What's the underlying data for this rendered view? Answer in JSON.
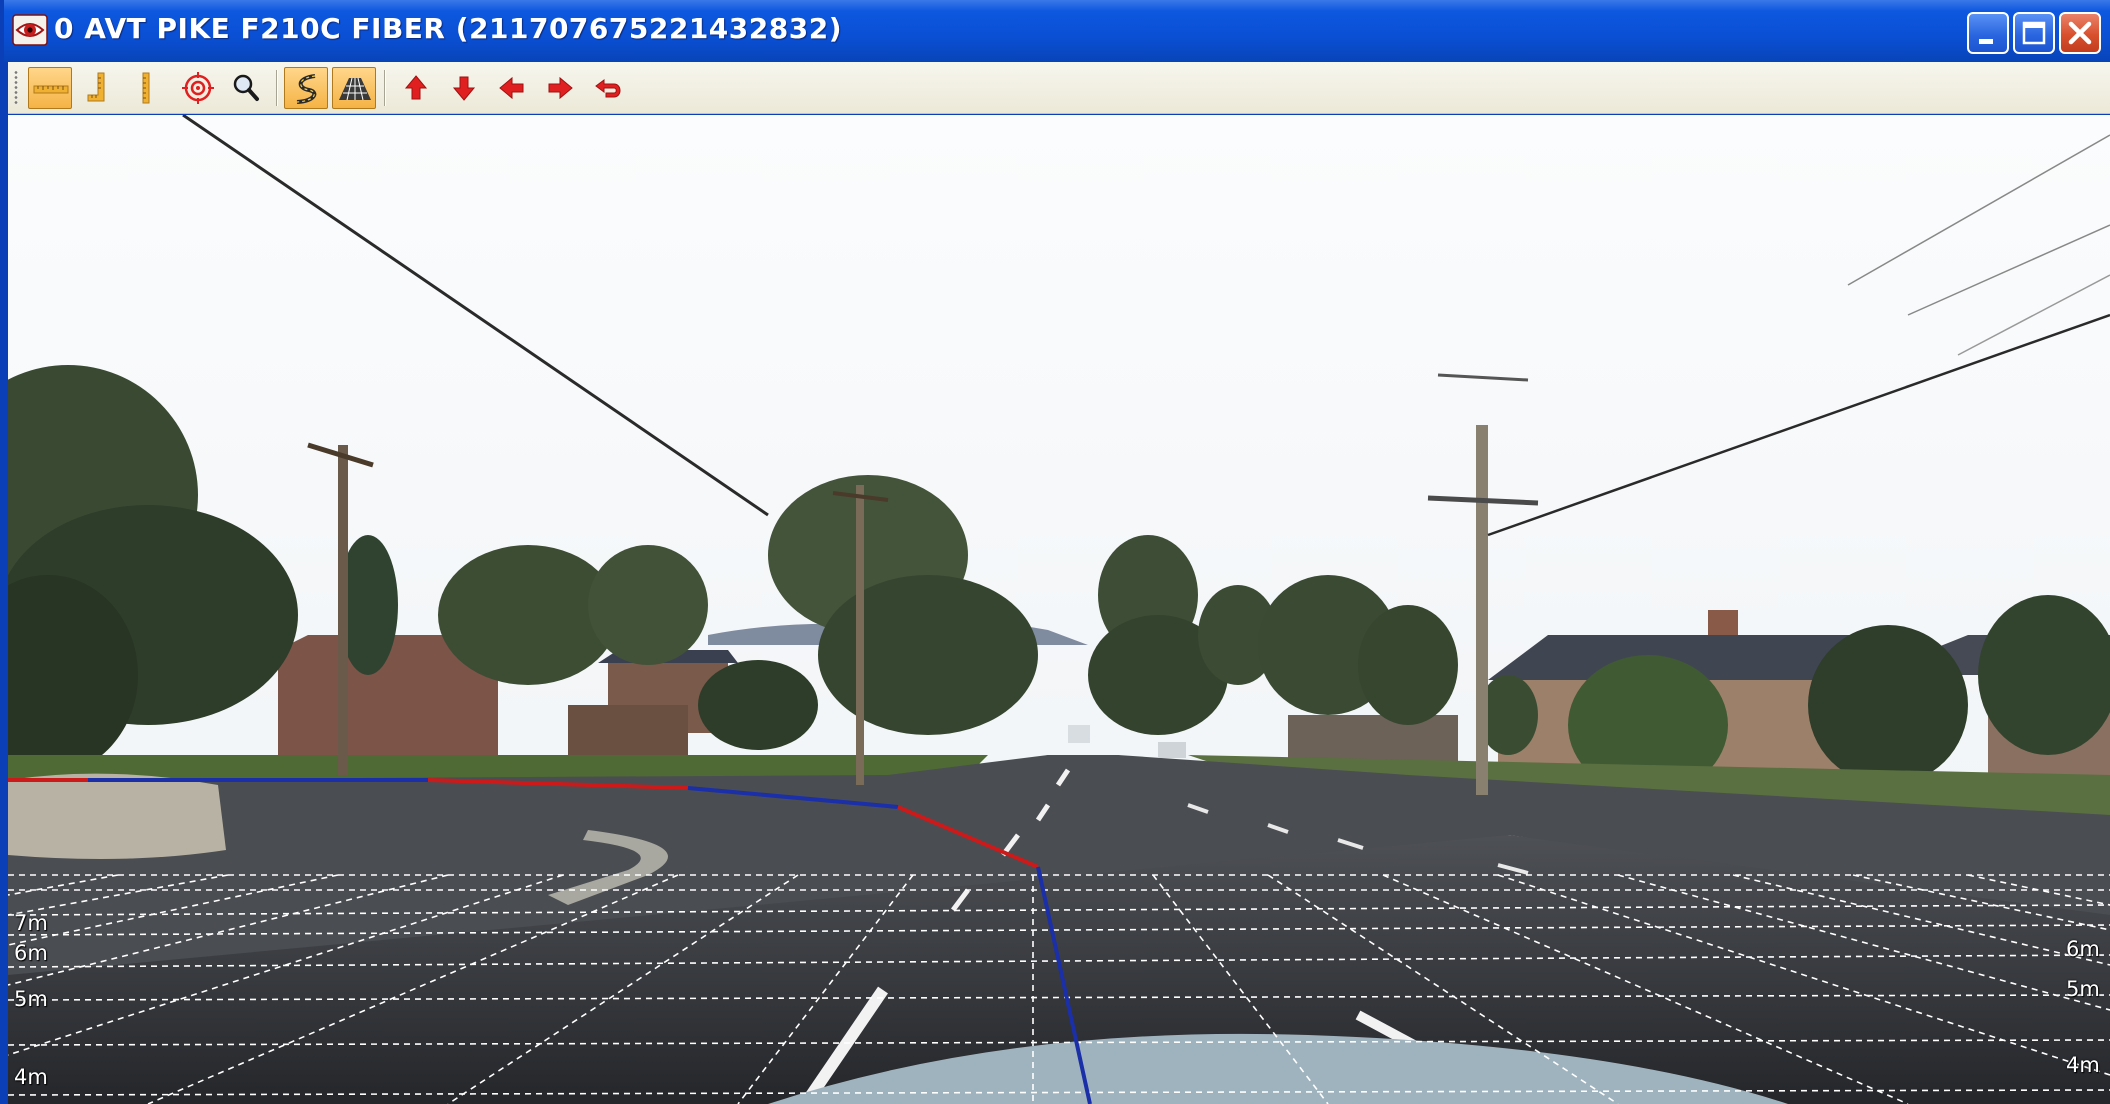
{
  "window": {
    "title": "0 AVT PIKE F210C FIBER (211707675221432832)",
    "title_color": "#ffffff",
    "titlebar_color": "#0a4fd4"
  },
  "title_buttons": [
    "minimize-icon",
    "maximize-icon",
    "close-icon"
  ],
  "toolbar": {
    "groups": [
      [
        {
          "icon": "horizontal-ruler-icon",
          "active": true
        },
        {
          "icon": "vertical-ruler-icon",
          "active": false
        },
        {
          "icon": "vertical-dotted-ruler-icon",
          "active": false
        },
        {
          "icon": "target-icon",
          "active": false
        },
        {
          "icon": "zoom-icon",
          "active": false
        }
      ],
      [
        {
          "icon": "lane-curve-icon",
          "active": true
        },
        {
          "icon": "road-grid-icon",
          "active": true
        }
      ],
      [
        {
          "icon": "arrow-up-icon",
          "active": false
        },
        {
          "icon": "arrow-down-icon",
          "active": false
        },
        {
          "icon": "arrow-left-icon",
          "active": false
        },
        {
          "icon": "arrow-right-icon",
          "active": false
        },
        {
          "icon": "undo-arrow-icon",
          "active": false
        }
      ]
    ],
    "active_color": "#f5b346",
    "arrow_color": "#e02020"
  },
  "overlay": {
    "left_distance_labels": [
      "7m",
      "6m",
      "5m",
      "4m"
    ],
    "right_distance_labels": [
      "6m",
      "5m",
      "4m"
    ],
    "grid_color": "#ffffff",
    "lane_colors": [
      "#cc1a1a",
      "#1a2fa8"
    ]
  }
}
